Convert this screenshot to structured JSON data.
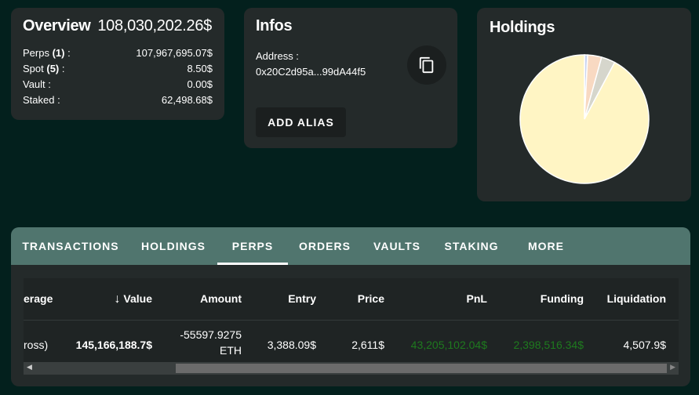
{
  "overview": {
    "title": "Overview",
    "total": "108,030,202.26$",
    "rows": [
      {
        "label": "Perps",
        "count": "(1)",
        "suffix": " :",
        "value": "107,967,695.07$"
      },
      {
        "label": "Spot",
        "count": "(5)",
        "suffix": " :",
        "value": "8.50$"
      },
      {
        "label": "Vault :",
        "count": "",
        "suffix": "",
        "value": "0.00$"
      },
      {
        "label": "Staked :",
        "count": "",
        "suffix": "",
        "value": "62,498.68$"
      }
    ]
  },
  "infos": {
    "title": "Infos",
    "address_label": "Address :",
    "address": "0x20C2d95a...99dA44f5",
    "copy_icon": "copy-icon",
    "add_alias": "ADD ALIAS"
  },
  "holdings": {
    "title": "Holdings",
    "slices": [
      {
        "fraction": 0.008,
        "color": "#c9d3ef"
      },
      {
        "fraction": 0.035,
        "color": "#f8d9c2"
      },
      {
        "fraction": 0.035,
        "color": "#d6d6cc"
      },
      {
        "fraction": 0.922,
        "color": "#fff5c4"
      }
    ]
  },
  "tabs": [
    {
      "label": "TRANSACTIONS"
    },
    {
      "label": "HOLDINGS"
    },
    {
      "label": "PERPS",
      "active": true
    },
    {
      "label": "ORDERS"
    },
    {
      "label": "VAULTS"
    },
    {
      "label": "STAKING"
    },
    {
      "label": "MORE"
    }
  ],
  "table": {
    "headers": [
      "erage",
      "Value",
      "Amount",
      "Entry",
      "Price",
      "PnL",
      "Funding",
      "Liquidation"
    ],
    "sort_icon": "arrow-down-icon",
    "row": {
      "leverage": "ross)",
      "value": "145,166,188.7$",
      "amount": "-55597.9275",
      "amount_unit": "ETH",
      "entry": "3,388.09$",
      "price": "2,611$",
      "pnl": "43,205,102.04$",
      "funding": "2,398,516.34$",
      "liquidation": "4,507.9$"
    },
    "positive_color": "#1e7a1e"
  }
}
